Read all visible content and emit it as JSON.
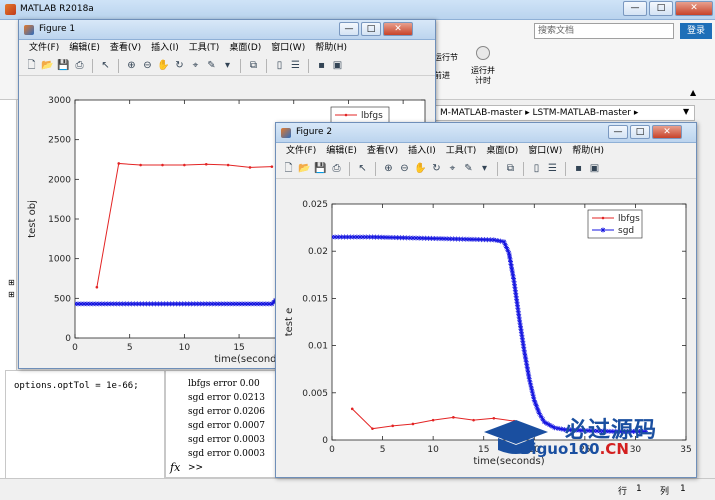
{
  "app": {
    "title": "MATLAB R2018a"
  },
  "header": {
    "search_placeholder": "搜索文档",
    "login_label": "登录"
  },
  "ribbon": {
    "item_a": "运行节",
    "item_b": "前进",
    "item_c": "运行并\n计时"
  },
  "path": {
    "text": "M-MATLAB-master  ▸  LSTM-MATLAB-master  ▸"
  },
  "workspace": {
    "line": "options.optTol = 1e-66;"
  },
  "command_window": {
    "lines": [
      "lbfgs error 0.00",
      "sgd error 0.0213",
      "sgd error 0.0206",
      "sgd error 0.0007",
      "sgd error 0.0003",
      "sgd error 0.0003"
    ],
    "prompt": ">>"
  },
  "status": {
    "row_label": "行",
    "row_value": "1",
    "col_label": "列",
    "col_value": "1"
  },
  "menus": [
    "文件(F)",
    "编辑(E)",
    "查看(V)",
    "插入(I)",
    "工具(T)",
    "桌面(D)",
    "窗口(W)",
    "帮助(H)"
  ],
  "figure1": {
    "title": "Figure 1"
  },
  "figure2": {
    "title": "Figure 2"
  },
  "watermark": {
    "text": "必过源码",
    "url_a": "Biguo100",
    "url_b": ".CN"
  },
  "colors": {
    "red": "#e32424",
    "blue": "#1515e0"
  },
  "chart_data": [
    {
      "type": "line",
      "xlabel": "time(seconds)",
      "ylabel": "test obj",
      "xlim": [
        0,
        32
      ],
      "ylim": [
        0,
        3000
      ],
      "xticks": [
        0,
        5,
        10,
        15,
        20,
        25,
        30
      ],
      "xtick_labels": [
        "0",
        "5",
        "10",
        "15",
        "20",
        "25",
        "30"
      ],
      "yticks": [
        0,
        500,
        1000,
        1500,
        2000,
        2500,
        3000
      ],
      "legend": "top-right",
      "series": [
        {
          "name": "lbfgs",
          "color": "#e32424",
          "marker": "dot",
          "x": [
            2,
            4,
            6,
            8,
            10,
            12,
            14,
            16,
            18
          ],
          "y": [
            640,
            2200,
            2180,
            2180,
            2180,
            2190,
            2180,
            2150,
            2160
          ]
        },
        {
          "name": "sgd",
          "color": "#1515e0",
          "marker": "star",
          "x": [
            0,
            3,
            6,
            9,
            12,
            15,
            18,
            18.5,
            19,
            19.5,
            20,
            20.5,
            21,
            22,
            23,
            24,
            25,
            25.5,
            26,
            27,
            28,
            29,
            30,
            31
          ],
          "y": [
            430,
            430,
            430,
            430,
            430,
            430,
            430,
            500,
            620,
            820,
            1000,
            1150,
            1270,
            1450,
            1600,
            1650,
            1700,
            1780,
            2000,
            2170,
            2300,
            2400,
            2480,
            2560
          ]
        }
      ]
    },
    {
      "type": "line",
      "xlabel": "time(seconds)",
      "ylabel": "test e",
      "xlim": [
        0,
        35
      ],
      "ylim": [
        0,
        0.025
      ],
      "xticks": [
        0,
        5,
        10,
        15,
        20,
        25,
        30,
        35
      ],
      "xtick_labels": [
        "0",
        "5",
        "10",
        "15",
        "20",
        "25",
        "30",
        "35"
      ],
      "yticks": [
        0,
        0.005,
        0.01,
        0.015,
        0.02,
        0.025
      ],
      "ytick_labels": [
        "0",
        "0.005",
        "0.01",
        "0.015",
        "0.02",
        "0.025"
      ],
      "legend": "top-right",
      "series": [
        {
          "name": "lbfgs",
          "color": "#e32424",
          "marker": "dot",
          "x": [
            2,
            4,
            6,
            8,
            10,
            12,
            14,
            16,
            18
          ],
          "y": [
            0.0033,
            0.0012,
            0.0015,
            0.0017,
            0.0021,
            0.0024,
            0.0021,
            0.0023,
            0.002
          ]
        },
        {
          "name": "sgd",
          "color": "#1515e0",
          "marker": "star",
          "x": [
            0,
            4,
            8,
            12,
            16,
            17,
            17.5,
            18,
            18.5,
            19,
            19.5,
            20,
            20.5,
            21,
            22,
            23,
            25,
            28,
            31
          ],
          "y": [
            0.0215,
            0.0215,
            0.0214,
            0.0213,
            0.0212,
            0.021,
            0.0198,
            0.0168,
            0.013,
            0.0095,
            0.0065,
            0.0042,
            0.0028,
            0.0019,
            0.0013,
            0.0011,
            0.001,
            0.0009,
            0.0009
          ]
        }
      ]
    }
  ]
}
